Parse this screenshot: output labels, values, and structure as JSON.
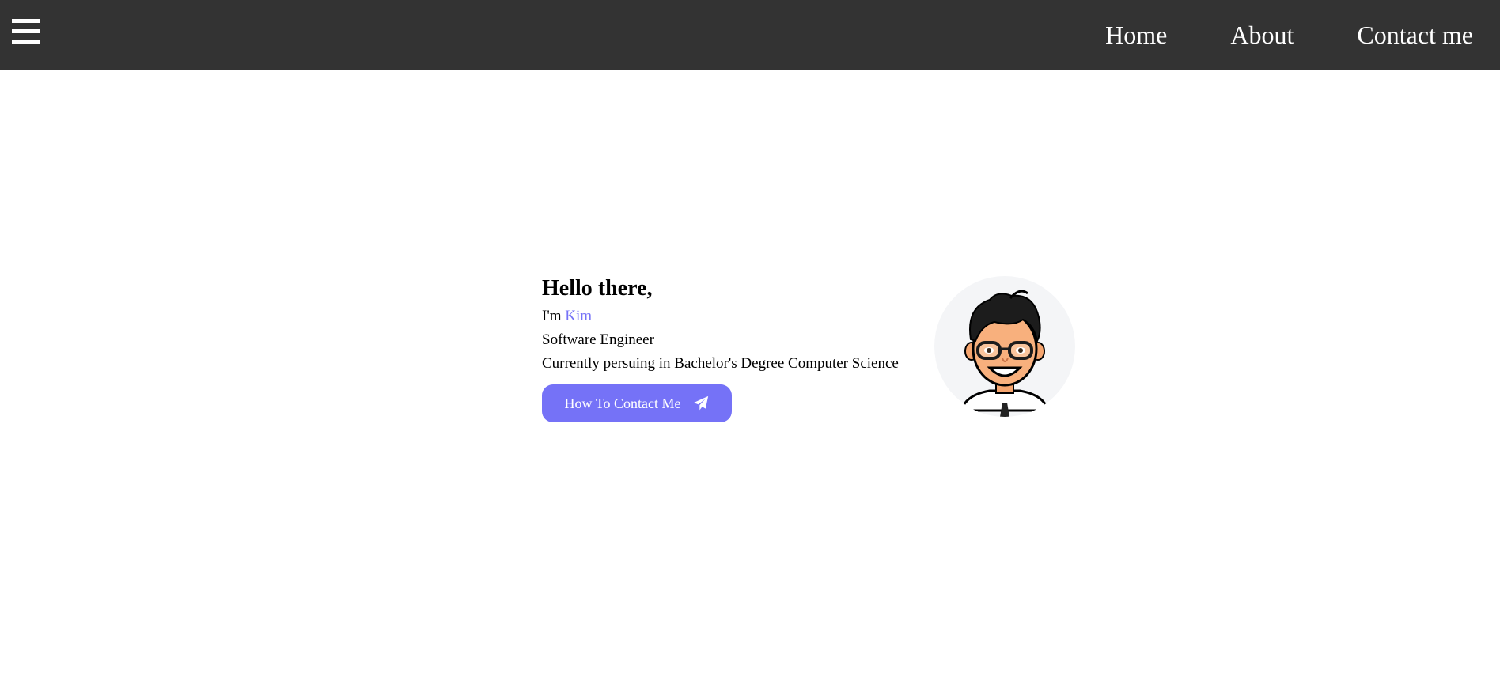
{
  "nav": {
    "menu_icon": "hamburger-menu-icon",
    "links": [
      {
        "label": "Home"
      },
      {
        "label": "About"
      },
      {
        "label": "Contact me"
      }
    ]
  },
  "hero": {
    "greeting": "Hello there,",
    "intro_prefix": "I'm",
    "name": "Kim",
    "role": "Software Engineer",
    "education": "Currently persuing in Bachelor's Degree Computer Science",
    "cta_label": "How To Contact Me",
    "cta_icon": "paper-plane-icon",
    "avatar_icon": "cartoon-avatar"
  },
  "colors": {
    "navbar_bg": "#333333",
    "accent": "#7572f7",
    "avatar_bg": "#f4f5f7"
  }
}
